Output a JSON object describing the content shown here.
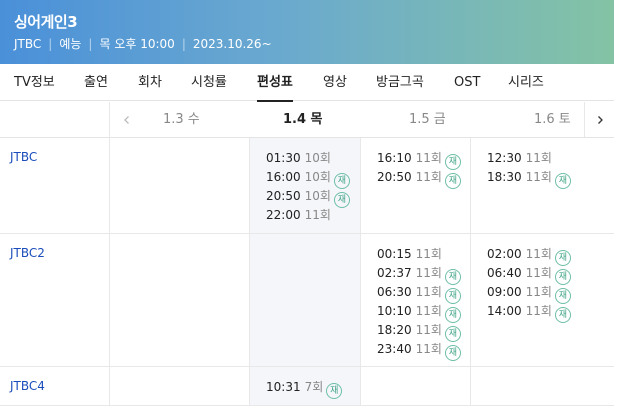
{
  "header": {
    "title": "싱어게인3",
    "channel": "JTBC",
    "genre": "예능",
    "airtime": "목 오후 10:00",
    "start_date": "2023.10.26~",
    "gradient_start": "#4a90d9",
    "gradient_end": "#84c3a4"
  },
  "tabs": [
    "TV정보",
    "출연",
    "회차",
    "시청률",
    "편성표",
    "영상",
    "방금그곡",
    "OST",
    "시리즈"
  ],
  "active_tab": "편성표",
  "dates": [
    "1.3 수",
    "1.4 목",
    "1.5 금",
    "1.6 토"
  ],
  "rerun_badge": "재",
  "rerun_color": "#3fa385",
  "channel_link_color": "#1a4dbb",
  "schedule": [
    {
      "channel": "JTBC",
      "days": [
        [],
        [
          {
            "time": "01:30",
            "ep": "10회",
            "rerun": false
          },
          {
            "time": "16:00",
            "ep": "10회",
            "rerun": true
          },
          {
            "time": "20:50",
            "ep": "10회",
            "rerun": true
          },
          {
            "time": "22:00",
            "ep": "11회",
            "rerun": false
          }
        ],
        [
          {
            "time": "16:10",
            "ep": "11회",
            "rerun": true
          },
          {
            "time": "20:50",
            "ep": "11회",
            "rerun": true
          }
        ],
        [
          {
            "time": "12:30",
            "ep": "11회",
            "rerun": false
          },
          {
            "time": "18:30",
            "ep": "11회",
            "rerun": true
          }
        ]
      ]
    },
    {
      "channel": "JTBC2",
      "days": [
        [],
        [],
        [
          {
            "time": "00:15",
            "ep": "11회",
            "rerun": false
          },
          {
            "time": "02:37",
            "ep": "11회",
            "rerun": true
          },
          {
            "time": "06:30",
            "ep": "11회",
            "rerun": true
          },
          {
            "time": "10:10",
            "ep": "11회",
            "rerun": true
          },
          {
            "time": "18:20",
            "ep": "11회",
            "rerun": true
          },
          {
            "time": "23:40",
            "ep": "11회",
            "rerun": true
          }
        ],
        [
          {
            "time": "02:00",
            "ep": "11회",
            "rerun": true
          },
          {
            "time": "06:40",
            "ep": "11회",
            "rerun": true
          },
          {
            "time": "09:00",
            "ep": "11회",
            "rerun": true
          },
          {
            "time": "14:00",
            "ep": "11회",
            "rerun": true
          }
        ]
      ]
    },
    {
      "channel": "JTBC4",
      "days": [
        [],
        [
          {
            "time": "10:31",
            "ep": "7회",
            "rerun": true
          }
        ],
        [],
        []
      ]
    }
  ]
}
